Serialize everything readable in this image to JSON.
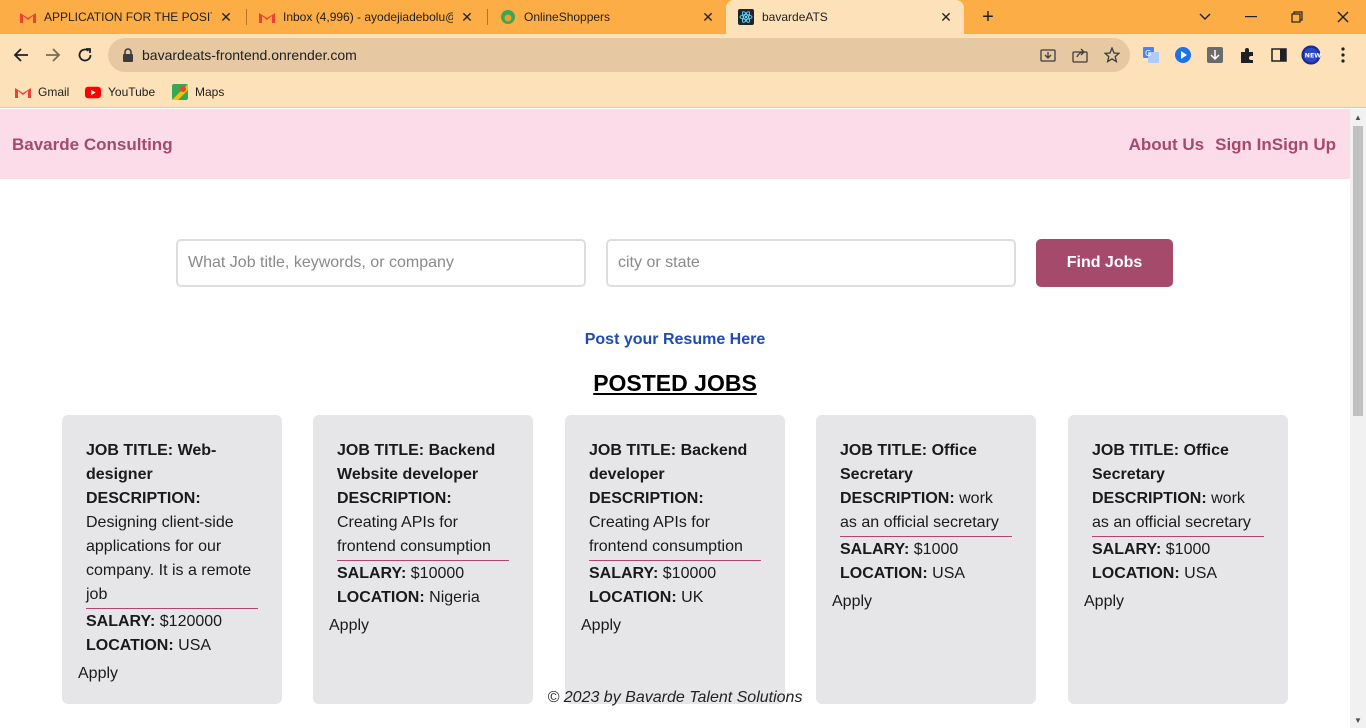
{
  "browser": {
    "tabs": [
      {
        "title": "APPLICATION FOR THE POSITION",
        "icon": "gmail-icon",
        "active": false
      },
      {
        "title": "Inbox (4,996) - ayodejiadebolu@",
        "icon": "gmail-icon",
        "active": false
      },
      {
        "title": "OnlineShoppers",
        "icon": "shop-icon",
        "active": false
      },
      {
        "title": "bavardeATS",
        "icon": "react-icon",
        "active": true
      }
    ],
    "url": "bavardeats-frontend.onrender.com",
    "bookmarks": [
      {
        "label": "Gmail",
        "icon": "gmail-icon"
      },
      {
        "label": "YouTube",
        "icon": "youtube-icon"
      },
      {
        "label": "Maps",
        "icon": "maps-icon"
      }
    ]
  },
  "site": {
    "brand": "Bavarde Consulting",
    "nav": {
      "about": "About Us",
      "signin": "Sign In",
      "signup": "Sign Up"
    },
    "search": {
      "keywords_placeholder": "What Job title, keywords, or company",
      "location_placeholder": "city or state",
      "button": "Find Jobs"
    },
    "resume_link": "Post your Resume Here",
    "section_title": "POSTED JOBS",
    "labels": {
      "title": "JOB TITLE:",
      "description": "DESCRIPTION:",
      "salary": "SALARY:",
      "location": "LOCATION:",
      "apply": "Apply"
    },
    "jobs": [
      {
        "title": "Web-designer",
        "description": "Designing client-side applications for our company. It is a remote job",
        "salary": "$120000",
        "location": "USA"
      },
      {
        "title": "Backend Website developer",
        "description": "Creating APIs for frontend consumption",
        "salary": "$10000",
        "location": "Nigeria"
      },
      {
        "title": "Backend developer",
        "description": "Creating APIs for frontend consumption",
        "salary": "$10000",
        "location": "UK"
      },
      {
        "title": "Office Secretary",
        "description": "work as an official secretary",
        "salary": "$1000",
        "location": "USA"
      },
      {
        "title": "Office Secretary",
        "description": "work as an official secretary",
        "salary": "$1000",
        "location": "USA"
      }
    ],
    "footer": "© 2023 by Bavarde Talent Solutions"
  },
  "colors": {
    "brand": "#a64a6c",
    "header_bg": "#fcdce8",
    "card_bg": "#e6e6e9",
    "link": "#1e4bb7",
    "tabbar": "#fdad45"
  }
}
